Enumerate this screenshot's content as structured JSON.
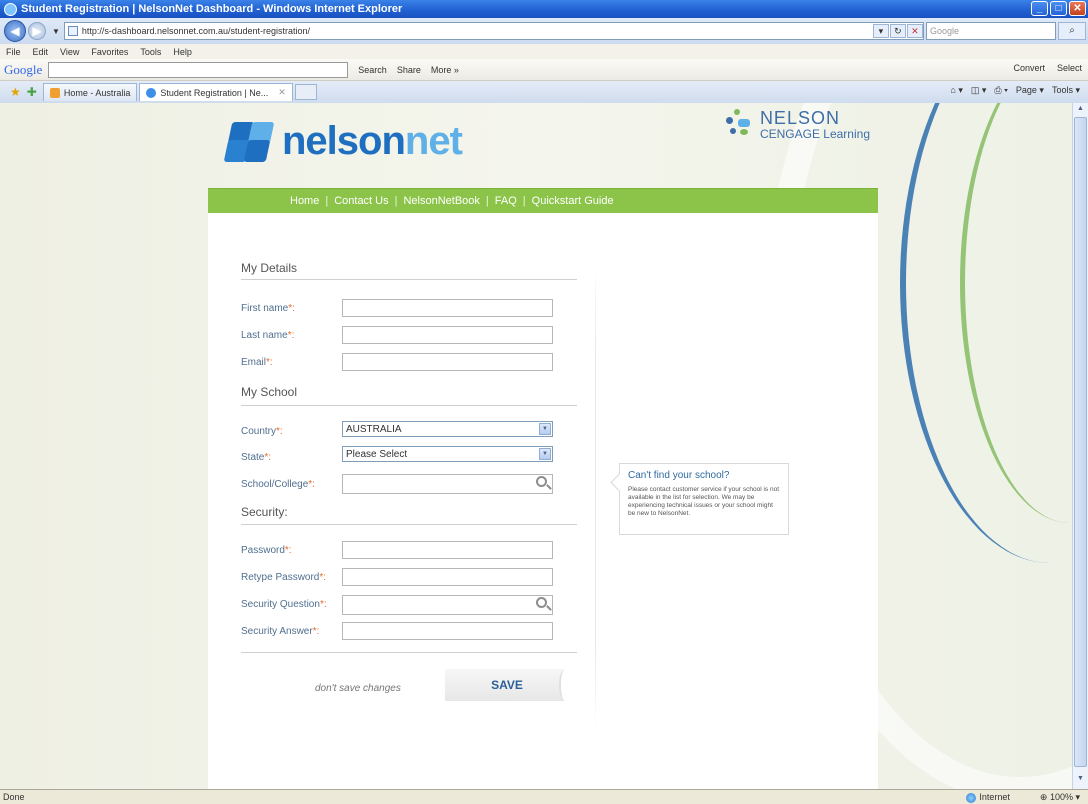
{
  "window": {
    "title": "Student Registration | NelsonNet Dashboard - Windows Internet Explorer"
  },
  "browser": {
    "url": "http://s-dashboard.nelsonnet.com.au/student-registration/",
    "search_placeholder": "Google",
    "menu": [
      "File",
      "Edit",
      "View",
      "Favorites",
      "Tools",
      "Help"
    ],
    "googlebar": {
      "logo": "Google",
      "search_label": "Search",
      "share_label": "Share",
      "more_label": "More »",
      "convert_label": "Convert",
      "select_label": "Select"
    },
    "tabs": [
      {
        "label": "Home - Australia"
      },
      {
        "label": "Student Registration | Ne..."
      }
    ],
    "commands": {
      "page": "Page",
      "tools": "Tools"
    },
    "status_left": "Done",
    "status_zone": "Internet",
    "zoom": "100%"
  },
  "site": {
    "logo_part1": "nelson",
    "logo_part2": "net",
    "publisher_line1": "NELSON",
    "publisher_line2": "CENGAGE Learning",
    "nav": [
      "Home",
      "Contact Us",
      "NelsonNetBook",
      "FAQ",
      "Quickstart Guide"
    ]
  },
  "form": {
    "sections": {
      "details": "My Details",
      "school": "My School",
      "security": "Security:"
    },
    "required_mark": "*:",
    "labels": {
      "first_name": "First name",
      "last_name": "Last name",
      "email": "Email",
      "country": "Country",
      "state": "State",
      "school": "School/College",
      "password": "Password",
      "retype_password": "Retype Password",
      "security_question": "Security Question",
      "security_answer": "Security Answer"
    },
    "values": {
      "first_name": "",
      "last_name": "",
      "email": "",
      "country": "AUSTRALIA",
      "state": "Please Select",
      "school": "",
      "password": "",
      "retype_password": "",
      "security_question": "",
      "security_answer": ""
    },
    "callout": {
      "title": "Can't find your school?",
      "text": "Please contact customer service if your school is not available in the list for selection. We may be experiencing technical issues or your school might be new to NelsonNet."
    },
    "dont_save": "don't save changes",
    "save": "SAVE"
  },
  "colors": {
    "nav_green": "#8cc44a",
    "brand_blue": "#1f6fc0",
    "label_blue": "#506f8f",
    "required_orange": "#e46d2b"
  }
}
